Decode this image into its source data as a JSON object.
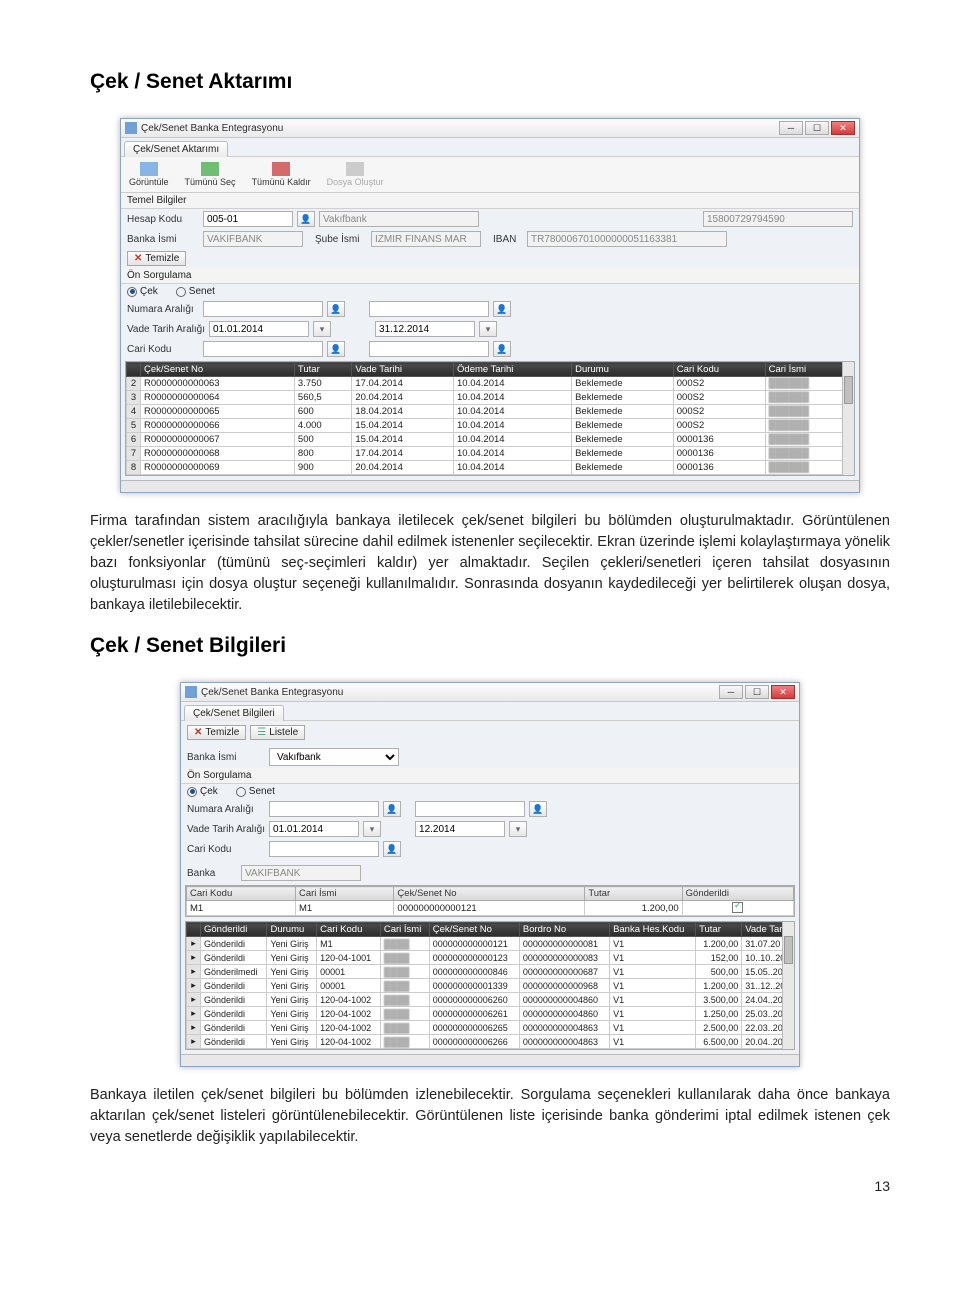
{
  "headings": {
    "h1": "Çek / Senet Aktarımı",
    "h2": "Çek / Senet Bilgileri"
  },
  "paragraphs": {
    "p1": "Firma tarafından sistem aracılığıyla bankaya iletilecek çek/senet bilgileri bu bölümden oluşturulmaktadır. Görüntülenen çekler/senetler içerisinde tahsilat sürecine dahil edilmek istenenler seçilecektir. Ekran üzerinde işlemi kolaylaştırmaya yönelik bazı fonksiyonlar (tümünü seç-seçimleri kaldır) yer almaktadır. Seçilen çekleri/senetleri içeren tahsilat dosyasının oluşturulması için dosya oluştur seçeneği kullanılmalıdır. Sonrasında dosyanın kaydedileceği yer belirtilerek oluşan dosya, bankaya iletilebilecektir.",
    "p2": "Bankaya iletilen çek/senet bilgileri bu bölümden izlenebilecektir. Sorgulama seçenekleri kullanılarak daha önce bankaya aktarılan çek/senet listeleri görüntülenebilecektir. Görüntülenen liste içerisinde banka gönderimi iptal edilmek istenen çek veya senetlerde değişiklik yapılabilecektir."
  },
  "page_number": "13",
  "win1": {
    "title": "Çek/Senet Banka Entegrasyonu",
    "tab": "Çek/Senet Aktarımı",
    "toolbar": [
      "Görüntüle",
      "Tümünü Seç",
      "Tümünü Kaldır",
      "Dosya Oluştur"
    ],
    "labels": {
      "temel": "Temel Bilgiler",
      "hesap": "Hesap Kodu",
      "banka": "Banka İsmi",
      "sube": "Şube İsmi",
      "iban": "IBAN",
      "temizle": "Temizle",
      "onsorgu": "Ön Sorgulama",
      "cek": "Çek",
      "senet": "Senet",
      "numara": "Numara Aralığı",
      "vade": "Vade Tarih Aralığı",
      "cari": "Cari Kodu"
    },
    "values": {
      "hesap": "005-01",
      "bank_disp": "Vakıfbank",
      "bank": "VAKIFBANK",
      "taxno": "15800729794590",
      "sube": "IZMIR FINANS MAR",
      "iban": "TR780006701000000051163381",
      "d1": "01.01.2014",
      "d2": "31.12.2014"
    },
    "columns": [
      "",
      "Çek/Senet No",
      "Tutar",
      "Vade Tarihi",
      "Ödeme Tarihi",
      "Durumu",
      "Cari Kodu",
      "Cari İsmi"
    ],
    "rows": [
      [
        "2",
        "R0000000000063",
        "3.750",
        "17.04.2014",
        "10.04.2014",
        "Beklemede",
        "000S2",
        ""
      ],
      [
        "3",
        "R0000000000064",
        "560,5",
        "20.04.2014",
        "10.04.2014",
        "Beklemede",
        "000S2",
        ""
      ],
      [
        "4",
        "R0000000000065",
        "600",
        "18.04.2014",
        "10.04.2014",
        "Beklemede",
        "000S2",
        ""
      ],
      [
        "5",
        "R0000000000066",
        "4.000",
        "15.04.2014",
        "10.04.2014",
        "Beklemede",
        "000S2",
        ""
      ],
      [
        "6",
        "R0000000000067",
        "500",
        "15.04.2014",
        "10.04.2014",
        "Beklemede",
        "0000136",
        ""
      ],
      [
        "7",
        "R0000000000068",
        "800",
        "17.04.2014",
        "10.04.2014",
        "Beklemede",
        "0000136",
        ""
      ],
      [
        "8",
        "R0000000000069",
        "900",
        "20.04.2014",
        "10.04.2014",
        "Beklemede",
        "0000136",
        ""
      ]
    ]
  },
  "win2": {
    "title": "Çek/Senet Banka Entegrasyonu",
    "tab": "Çek/Senet Bilgileri",
    "labels": {
      "temizle": "Temizle",
      "listele": "Listele",
      "banka": "Banka İsmi",
      "onsorgu": "Ön Sorgulama",
      "cek": "Çek",
      "senet": "Senet",
      "numara": "Numara Aralığı",
      "vade": "Vade Tarih Aralığı",
      "cari": "Cari Kodu",
      "bankasec": "Banka"
    },
    "values": {
      "banka": "Vakıfbank",
      "d1": "01.01.2014",
      "d2": "12.2014",
      "bankasec": "VAKIFBANK"
    },
    "ucols": [
      "Cari Kodu",
      "Cari İsmi",
      "Çek/Senet No",
      "Tutar",
      "Gönderildi"
    ],
    "urow": [
      "M1",
      "M1",
      "000000000000121",
      "1.200,00",
      "✓"
    ],
    "lcols": [
      "",
      "Gönderildi",
      "Durumu",
      "Cari Kodu",
      "Cari İsmi",
      "Çek/Senet No",
      "Bordro No",
      "Banka Hes.Kodu",
      "Tutar",
      "Vade Tari"
    ],
    "lrows": [
      [
        "",
        "Gönderildi",
        "Yeni Giriş",
        "M1",
        "",
        "000000000000121",
        "000000000000081",
        "V1",
        "1.200,00",
        "31.07.20"
      ],
      [
        "",
        "Gönderildi",
        "Yeni Giriş",
        "120-04-1001",
        "",
        "000000000000123",
        "000000000000083",
        "V1",
        "152,00",
        "10..10..20"
      ],
      [
        "",
        "Gönderilmedi",
        "Yeni Giriş",
        "00001",
        "",
        "000000000000846",
        "000000000000687",
        "V1",
        "500,00",
        "15.05..20"
      ],
      [
        "",
        "Gönderildi",
        "Yeni Giriş",
        "00001",
        "",
        "000000000001339",
        "000000000000968",
        "V1",
        "1.200,00",
        "31..12..20"
      ],
      [
        "",
        "Gönderildi",
        "Yeni Giriş",
        "120-04-1002",
        "",
        "000000000006260",
        "000000000004860",
        "V1",
        "3.500,00",
        "24.04..20"
      ],
      [
        "",
        "Gönderildi",
        "Yeni Giriş",
        "120-04-1002",
        "",
        "000000000006261",
        "000000000004860",
        "V1",
        "1.250,00",
        "25.03..20"
      ],
      [
        "",
        "Gönderildi",
        "Yeni Giriş",
        "120-04-1002",
        "",
        "000000000006265",
        "000000000004863",
        "V1",
        "2.500,00",
        "22.03..20"
      ],
      [
        "",
        "Gönderildi",
        "Yeni Giriş",
        "120-04-1002",
        "",
        "000000000006266",
        "000000000004863",
        "V1",
        "6.500,00",
        "20.04..20"
      ]
    ]
  }
}
